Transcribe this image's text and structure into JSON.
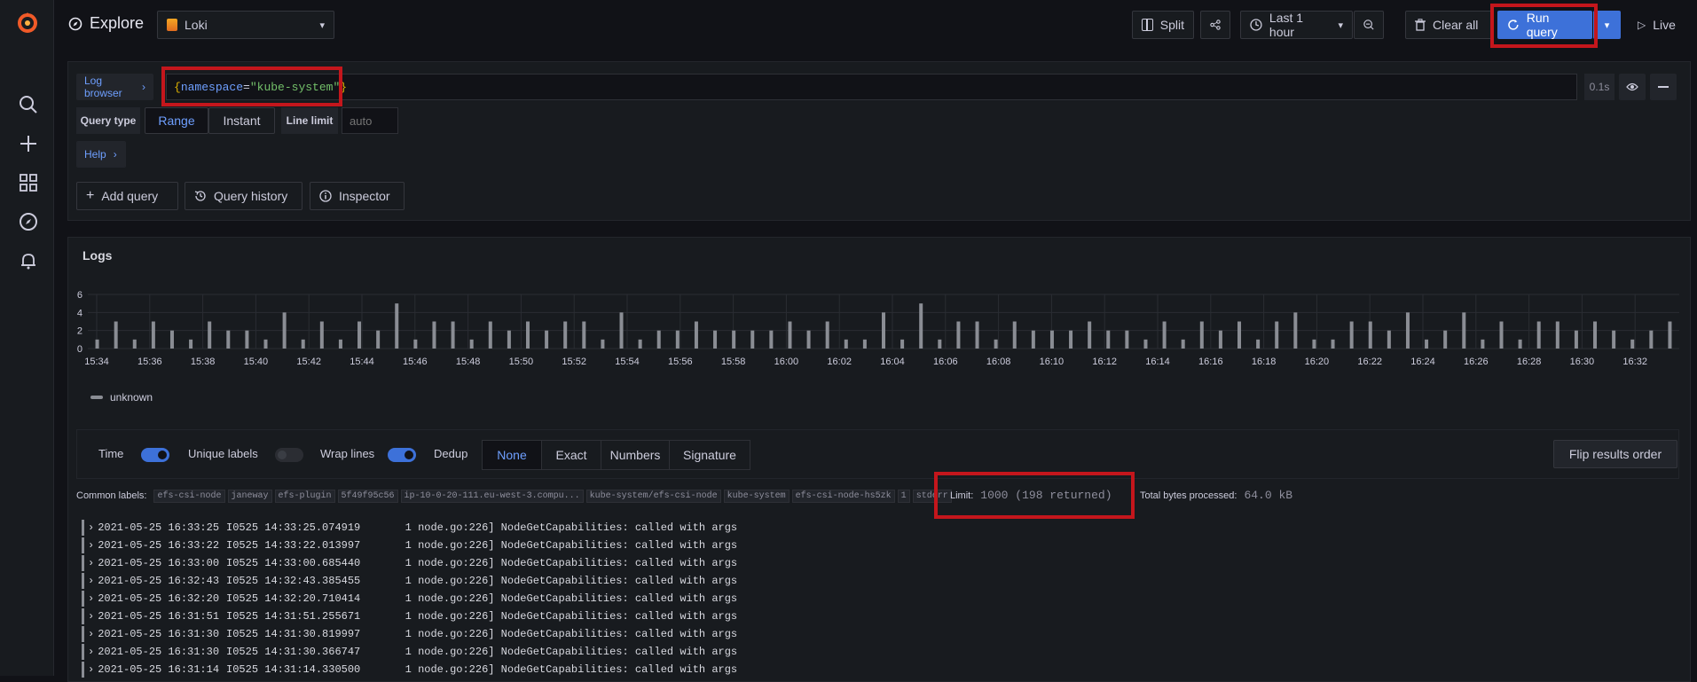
{
  "app": {
    "title": "Explore"
  },
  "datasource": {
    "name": "Loki"
  },
  "toolbar": {
    "split": "Split",
    "time_range": "Last 1 hour",
    "clear": "Clear all",
    "run": "Run query",
    "live": "Live"
  },
  "query": {
    "log_browser": "Log browser",
    "expr_open": "{",
    "expr_key": "namespace",
    "expr_eq": "=",
    "expr_val": "\"kube-system\"",
    "expr_close": "}",
    "timing": "0.1s",
    "query_type_label": "Query type",
    "range": "Range",
    "instant": "Instant",
    "line_limit_label": "Line limit",
    "line_limit_placeholder": "auto",
    "help": "Help"
  },
  "actions": {
    "add_query": "Add query",
    "history": "Query history",
    "inspector": "Inspector"
  },
  "logs_panel": {
    "title": "Logs",
    "legend": "unknown",
    "time": "Time",
    "unique": "Unique labels",
    "wrap": "Wrap lines",
    "dedup": "Dedup",
    "dedup_options": [
      "None",
      "Exact",
      "Numbers",
      "Signature"
    ],
    "flip": "Flip results order",
    "common_labels_title": "Common labels:",
    "common_labels": [
      "efs-csi-node",
      "janeway",
      "efs-plugin",
      "5f49f95c56",
      "ip-10-0-20-111.eu-west-3.compu...",
      "kube-system/efs-csi-node",
      "kube-system",
      "efs-csi-node-hs5zk",
      "1",
      "stderr"
    ],
    "limit_label": "Limit:",
    "limit_value": "1000 (198 returned)",
    "bytes_label": "Total bytes processed:",
    "bytes_value": "64.0 kB"
  },
  "chart_data": {
    "type": "bar",
    "x_ticks": [
      "15:34",
      "15:36",
      "15:38",
      "15:40",
      "15:42",
      "15:44",
      "15:46",
      "15:48",
      "15:50",
      "15:52",
      "15:54",
      "15:56",
      "15:58",
      "16:00",
      "16:02",
      "16:04",
      "16:06",
      "16:08",
      "16:10",
      "16:12",
      "16:14",
      "16:16",
      "16:18",
      "16:20",
      "16:22",
      "16:24",
      "16:26",
      "16:28",
      "16:30",
      "16:32"
    ],
    "y_ticks": [
      "0",
      "2",
      "4",
      "6"
    ],
    "ylim": [
      0,
      6
    ],
    "series": [
      {
        "name": "unknown",
        "values": [
          1,
          3,
          1,
          3,
          2,
          1,
          3,
          2,
          2,
          1,
          4,
          1,
          3,
          1,
          3,
          2,
          5,
          1,
          3,
          3,
          1,
          3,
          2,
          3,
          2,
          3,
          3,
          1,
          4,
          1,
          2,
          2,
          3,
          2,
          2,
          2,
          2,
          3,
          2,
          3,
          1,
          1,
          4,
          1,
          5,
          1,
          3,
          3,
          1,
          3,
          2,
          2,
          2,
          3,
          2,
          2,
          1,
          3,
          1,
          3,
          2,
          3,
          1,
          3,
          4,
          1,
          1,
          3,
          3,
          2,
          4,
          1,
          2,
          4,
          1,
          3,
          1,
          3,
          3,
          2,
          3,
          2,
          1,
          2,
          3
        ]
      }
    ],
    "legend": "bottom-left"
  },
  "log_rows": [
    {
      "ts": "2021-05-25 16:33:25",
      "msg": "I0525 14:33:25.074919       1 node.go:226] NodeGetCapabilities: called with args"
    },
    {
      "ts": "2021-05-25 16:33:22",
      "msg": "I0525 14:33:22.013997       1 node.go:226] NodeGetCapabilities: called with args"
    },
    {
      "ts": "2021-05-25 16:33:00",
      "msg": "I0525 14:33:00.685440       1 node.go:226] NodeGetCapabilities: called with args"
    },
    {
      "ts": "2021-05-25 16:32:43",
      "msg": "I0525 14:32:43.385455       1 node.go:226] NodeGetCapabilities: called with args"
    },
    {
      "ts": "2021-05-25 16:32:20",
      "msg": "I0525 14:32:20.710414       1 node.go:226] NodeGetCapabilities: called with args"
    },
    {
      "ts": "2021-05-25 16:31:51",
      "msg": "I0525 14:31:51.255671       1 node.go:226] NodeGetCapabilities: called with args"
    },
    {
      "ts": "2021-05-25 16:31:30",
      "msg": "I0525 14:31:30.819997       1 node.go:226] NodeGetCapabilities: called with args"
    },
    {
      "ts": "2021-05-25 16:31:30",
      "msg": "I0525 14:31:30.366747       1 node.go:226] NodeGetCapabilities: called with args"
    },
    {
      "ts": "2021-05-25 16:31:14",
      "msg": "I0525 14:31:14.330500       1 node.go:226] NodeGetCapabilities: called with args"
    }
  ],
  "colors": {
    "accent": "#3d71d9",
    "highlight": "#c4161c",
    "bar": "#8a8d94"
  }
}
